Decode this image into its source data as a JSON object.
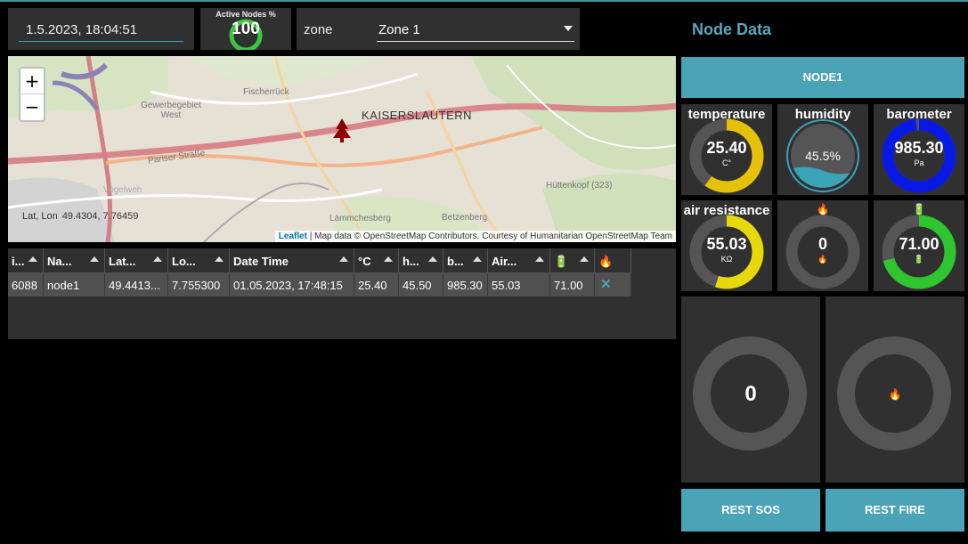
{
  "header": {
    "datetime": "1.5.2023, 18:04:51",
    "active_nodes_label": "Active Nodes %",
    "active_nodes_value": "100",
    "active_nodes_fraction": 1.0,
    "zone_label": "zone",
    "zone_selected": "Zone 1"
  },
  "map": {
    "zoom_in": "+",
    "zoom_out": "−",
    "city_label": "KAISERSLAUTERN",
    "place_labels": [
      "Fischerrück",
      "Gewerbegebiet West",
      "Pariser Straße",
      "Lämmchesberg",
      "Betzenberg",
      "Hüttenkopf (323)",
      "Vogelweh"
    ],
    "latlon_label": "Lat, Lon",
    "latlon_value": "49.4304, 7.76459",
    "attribution_link": "Leaflet",
    "attribution_text": " | Map data © OpenStreetMap Contributors. Courtesy of Humanitarian OpenStreetMap Team"
  },
  "table": {
    "headers": [
      "i...",
      "Na...",
      "Lat...",
      "Lo...",
      "Date Time",
      "°C",
      "h...",
      "b...",
      "Air...",
      "🔋",
      "🔥"
    ],
    "rows": [
      [
        "6088",
        "node1",
        "49.4413...",
        "7.755300",
        "01.05.2023, 17:48:15",
        "25.40",
        "45.50",
        "985.30",
        "55.03",
        "71.00",
        "✕"
      ]
    ]
  },
  "panel": {
    "title": "Node Data",
    "node_button": "NODE1",
    "gauges": [
      {
        "title": "temperature",
        "value": "25.40",
        "unit": "C°",
        "fraction": 0.6,
        "color": "#e6c10a"
      },
      {
        "title": "humidity",
        "value": "45.5%",
        "fraction": 0.455,
        "color": "#3aa3b8"
      },
      {
        "title": "barometer",
        "value": "985.30",
        "unit": "Pa",
        "fraction": 0.985,
        "color": "#0a1ae6"
      },
      {
        "title": "air resistance",
        "value": "55.03",
        "unit": "KΩ",
        "fraction": 0.55,
        "color": "#e6d80a"
      },
      {
        "title": "🔥",
        "value": "0",
        "unit": "🔥",
        "fraction": 0,
        "color": "#e65a0a"
      },
      {
        "title": "🔋",
        "value": "71.00",
        "unit": "🔋",
        "fraction": 0.71,
        "color": "#2fc52f"
      }
    ],
    "sos_value": "0",
    "fire_value": "🔥",
    "rest_sos": "REST SOS",
    "rest_fire": "REST FIRE"
  }
}
